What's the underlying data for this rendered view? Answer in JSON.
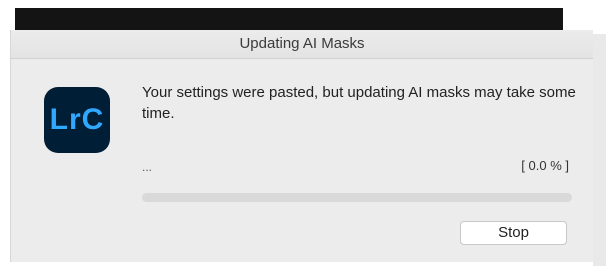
{
  "dialog": {
    "title": "Updating AI Masks",
    "app_icon": {
      "name": "lightroom-classic-icon",
      "label": "LrC",
      "background": "#001e36",
      "foreground": "#31a8ff"
    },
    "message": "Your settings were pasted, but updating AI masks may take some time.",
    "status_text": "...",
    "percent_text": "[ 0.0 % ]",
    "progress": 0.0,
    "stop_label": "Stop"
  }
}
